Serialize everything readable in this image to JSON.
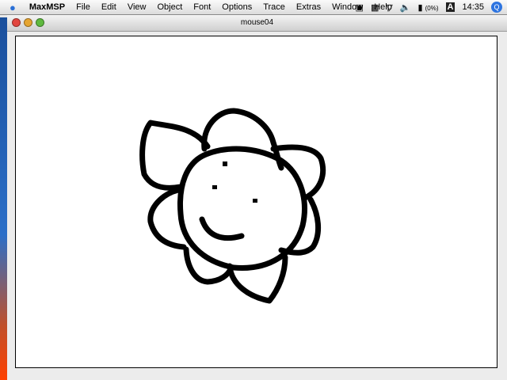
{
  "menubar": {
    "apple": "",
    "app": "MaxMSP",
    "items": [
      "File",
      "Edit",
      "View",
      "Object",
      "Font",
      "Options",
      "Trace",
      "Extras",
      "Window",
      "Help"
    ],
    "status": {
      "battery": "(0%)",
      "input": "A",
      "clock": "14:35",
      "spotlight": "Q"
    }
  },
  "window": {
    "title": "mouse04"
  }
}
